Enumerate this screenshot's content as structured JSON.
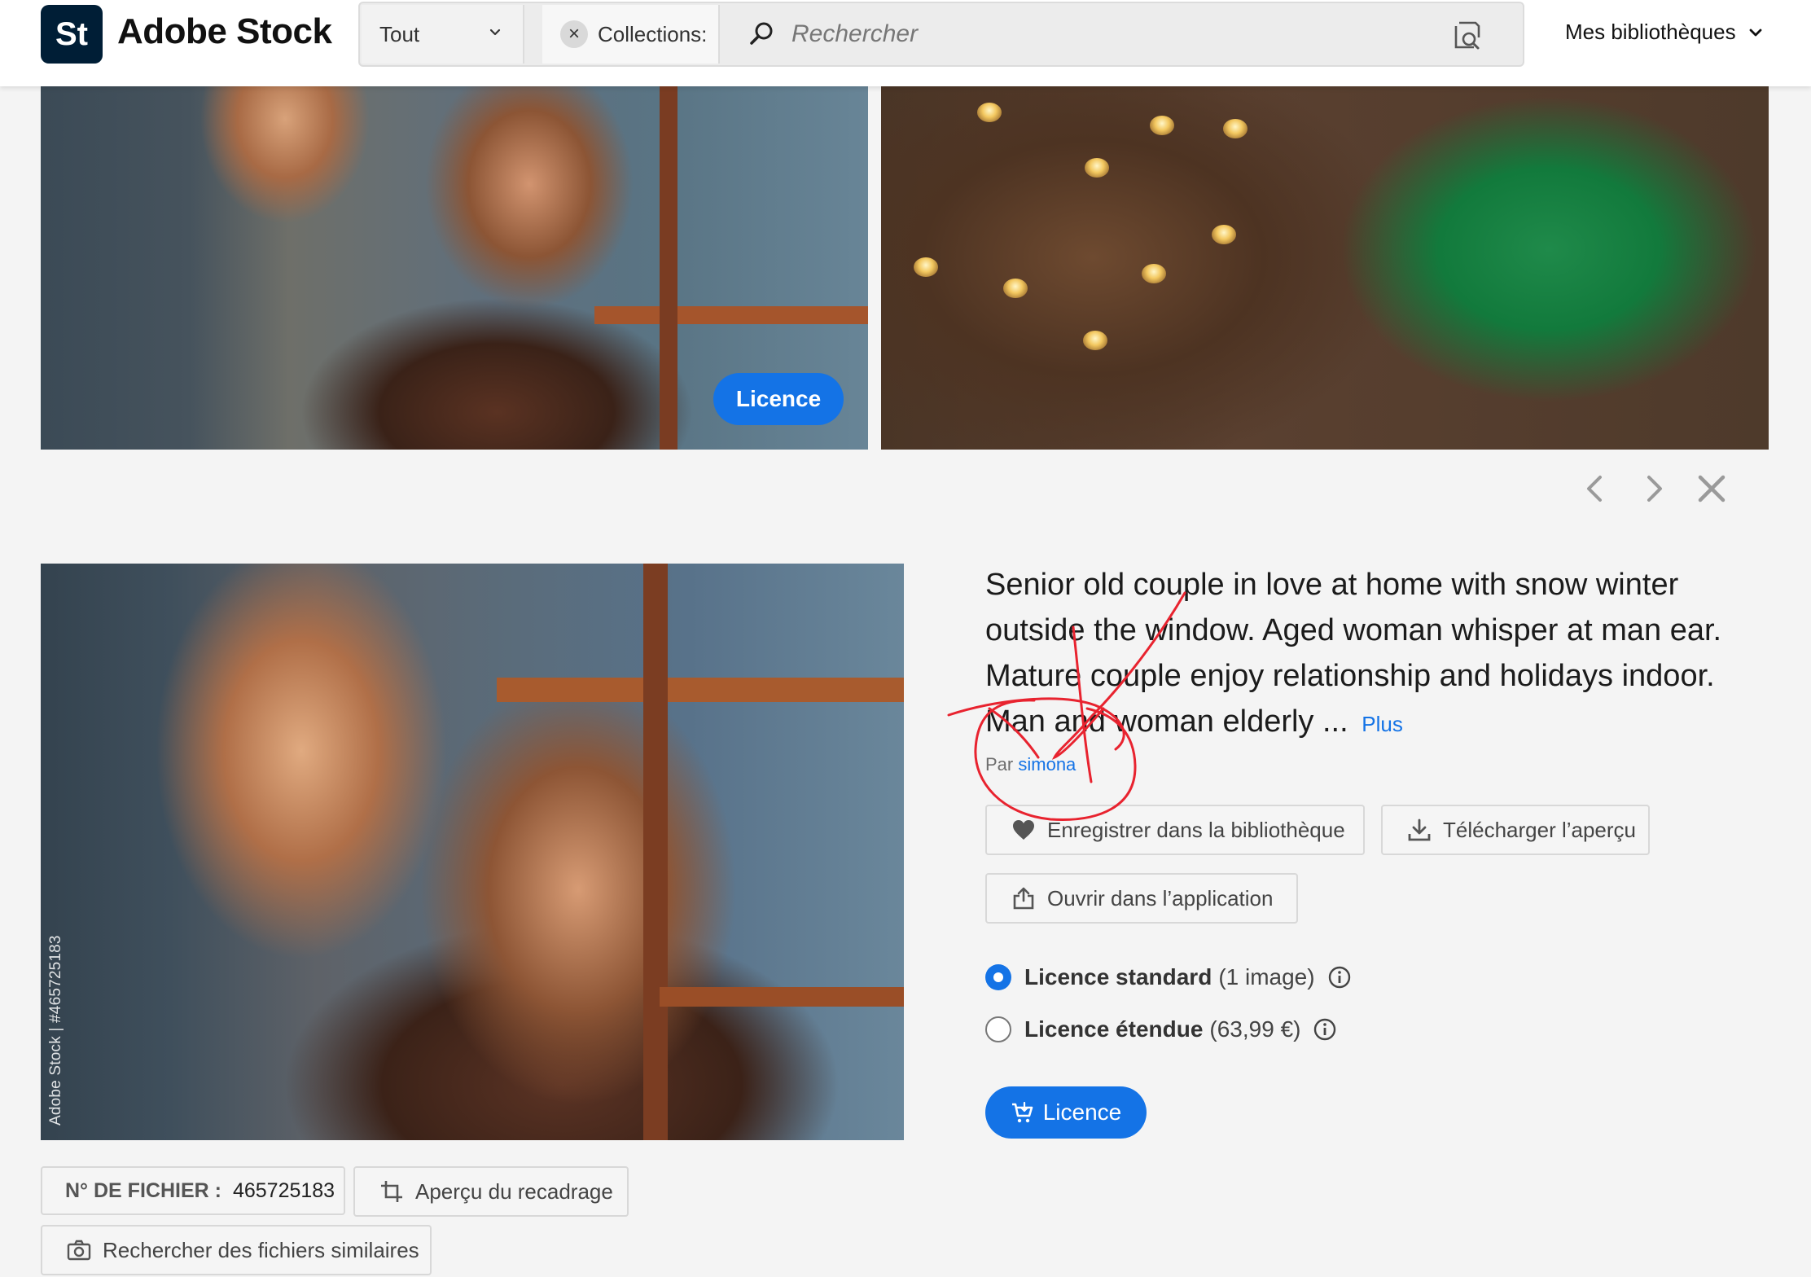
{
  "header": {
    "logo_badge": "St",
    "logo_text": "Adobe Stock",
    "scope": {
      "selected": "Tout"
    },
    "collection_chip": {
      "label": "Collections:"
    },
    "search": {
      "placeholder": "Rechercher",
      "value": ""
    },
    "libraries_label": "Mes bibliothèques"
  },
  "results": {
    "licence_pill_label": "Licence"
  },
  "preview": {
    "watermark": "Adobe Stock | #465725183",
    "file_id_label": "N° DE FICHIER :",
    "file_id_value": "465725183",
    "crop_preview_label": "Aperçu du recadrage",
    "similar_search_label": "Rechercher des fichiers similaires"
  },
  "details": {
    "title": "Senior old couple in love at home with snow winter outside the window. Aged woman whisper at man ear. Mature couple enjoy relationship and holidays indoor. Man and woman elderly ...",
    "more_link": "Plus",
    "by_prefix": "Par",
    "author": "simona",
    "save_library_label": "Enregistrer dans la bibliothèque",
    "download_preview_label": "Télécharger l’aperçu",
    "open_in_app_label": "Ouvrir dans l’application",
    "licence_options": [
      {
        "name": "Licence standard",
        "detail": "(1 image)",
        "selected": true
      },
      {
        "name": "Licence étendue",
        "detail": "(63,99 €)",
        "selected": false
      }
    ],
    "licence_button_label": "Licence"
  },
  "icons": {
    "search": "search-icon",
    "visual_search": "visual-search-icon",
    "heart": "heart-icon",
    "download": "download-icon",
    "share": "share-icon",
    "cart": "cart-icon",
    "crop": "crop-icon",
    "camera": "camera-icon",
    "info": "info-icon"
  },
  "colors": {
    "accent": "#1473e6",
    "logo_bg": "#001e36",
    "page_bg": "#f4f4f4",
    "annotation": "#e8232f"
  }
}
